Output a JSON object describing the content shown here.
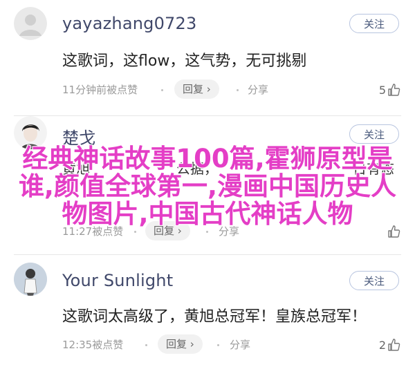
{
  "comments": [
    {
      "username": "yayazhang0723",
      "follow_label": "关注",
      "text": "这歌词，这flow，这气势，无可挑剔",
      "time": "11分钟前被点赞",
      "reply_label": "回复",
      "share_label": "分享",
      "likes": "5"
    },
    {
      "username": "楚戈",
      "follow_label": "关注",
      "text_fragment_left": "黄旭",
      "text_fragment_mid": "公据，",
      "text_fragment_right": "日有态",
      "time": "11:27被点赞",
      "reply_label": "回复",
      "share_label": "分享"
    },
    {
      "username": "Your Sunlight",
      "follow_label": "关注",
      "text": "这歌词太高级了，黄旭总冠军！皇族总冠军！",
      "time": "12:35被点赞",
      "reply_label": "回复",
      "share_label": "分享",
      "likes": "2"
    }
  ],
  "overlay_title": "经典神话故事100篇,霍狮原型是谁,颜值全球第一,漫画中国历史人物图片,中国古代神话人物",
  "icons": {
    "like": "thumbs-up-icon",
    "reply_chevron": "chevron-right-icon"
  }
}
